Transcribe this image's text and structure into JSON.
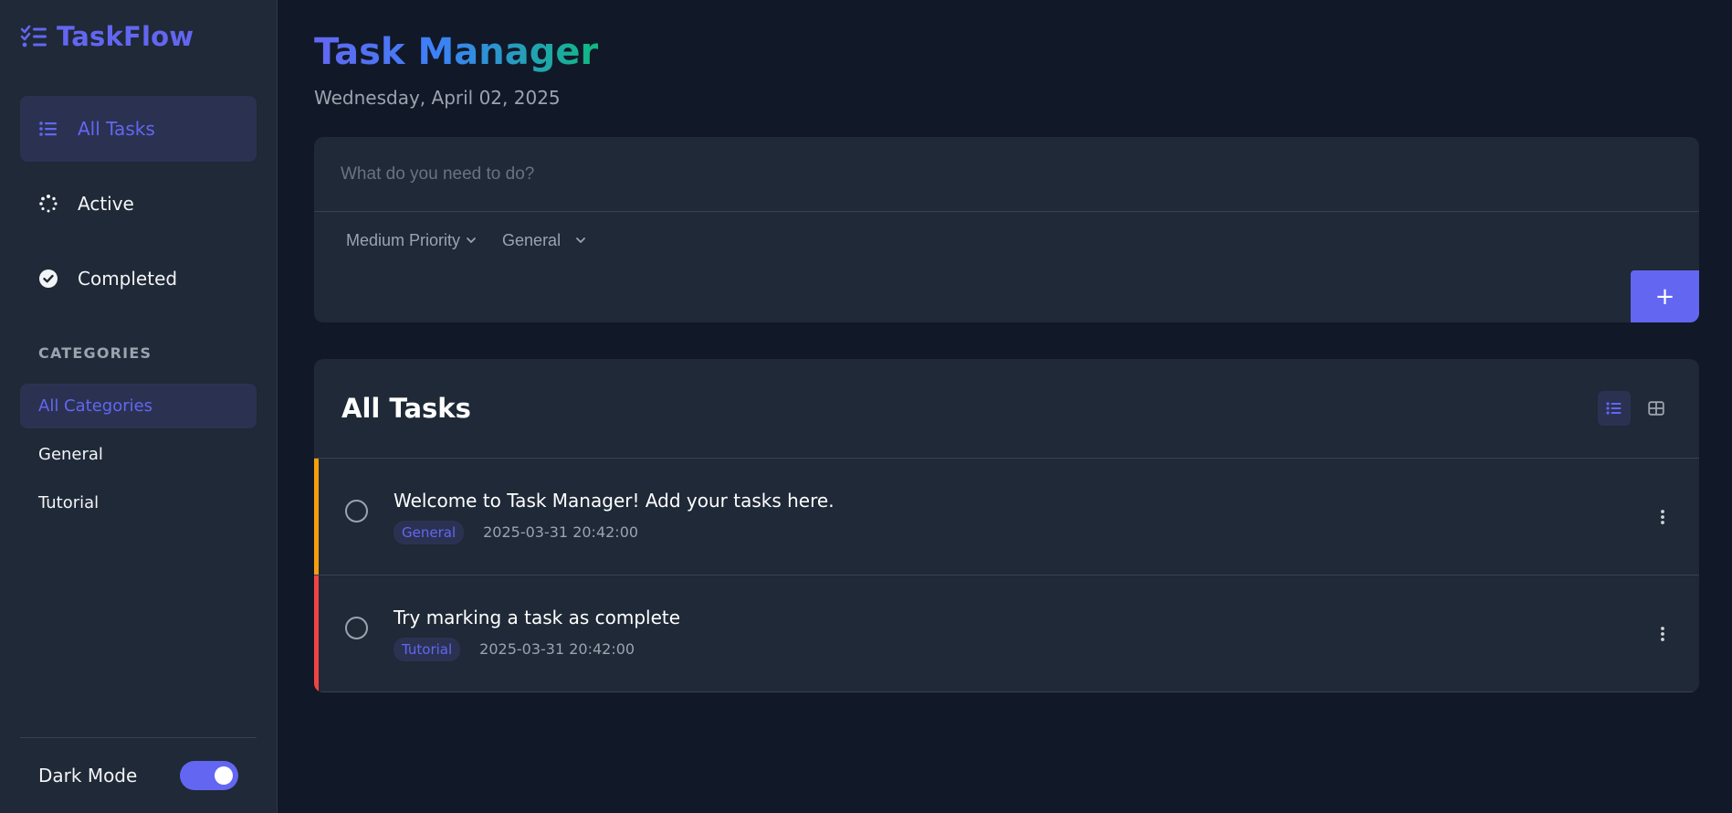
{
  "app": {
    "name": "TaskFlow"
  },
  "nav": {
    "items": [
      {
        "label": "All Tasks",
        "icon": "list-icon",
        "active": true
      },
      {
        "label": "Active",
        "icon": "spinner-icon",
        "active": false
      },
      {
        "label": "Completed",
        "icon": "check-circle-icon",
        "active": false
      }
    ]
  },
  "categories": {
    "title": "CATEGORIES",
    "items": [
      {
        "label": "All Categories",
        "active": true
      },
      {
        "label": "General",
        "active": false
      },
      {
        "label": "Tutorial",
        "active": false
      }
    ]
  },
  "footer": {
    "dark_mode_label": "Dark Mode",
    "dark_mode_on": true
  },
  "header": {
    "title": "Task Manager",
    "date": "Wednesday, April 02, 2025"
  },
  "add_task": {
    "placeholder": "What do you need to do?",
    "priority": "Medium Priority",
    "category": "General",
    "add_label": "+"
  },
  "tasks": {
    "title": "All Tasks",
    "items": [
      {
        "title": "Welcome to Task Manager! Add your tasks here.",
        "category": "General",
        "date": "2025-03-31 20:42:00",
        "priority_color": "#f59e0b"
      },
      {
        "title": "Try marking a task as complete",
        "category": "Tutorial",
        "date": "2025-03-31 20:42:00",
        "priority_color": "#ef4444"
      }
    ]
  },
  "colors": {
    "accent": "#6366f1",
    "background": "#111827",
    "surface": "#1f2937",
    "priority_medium": "#f59e0b",
    "priority_high": "#ef4444"
  }
}
